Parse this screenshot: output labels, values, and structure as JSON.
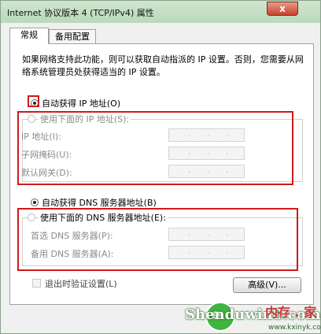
{
  "window": {
    "title": "Internet 协议版本 4 (TCP/IPv4) 属性",
    "close": "x"
  },
  "tabs": [
    {
      "label": "常规"
    },
    {
      "label": "备用配置"
    }
  ],
  "description": "如果网络支持此功能，则可以获取自动指派的 IP 设置。否则，您需要从网络系统管理员处获得适当的 IP 设置。",
  "ip": {
    "auto_label": "自动获得 IP 地址(O)",
    "manual_label": "使用下面的 IP 地址(S):",
    "fields": [
      {
        "label": "IP 地址(I):"
      },
      {
        "label": "子网掩码(U):"
      },
      {
        "label": "默认网关(D):"
      }
    ]
  },
  "dns": {
    "auto_label": "自动获得 DNS 服务器地址(B)",
    "manual_label": "使用下面的 DNS 服务器地址(E):",
    "fields": [
      {
        "label": "首选 DNS 服务器(P):"
      },
      {
        "label": "备用 DNS 服务器(A):"
      }
    ]
  },
  "validate_label": "退出时验证设置(L)",
  "advanced_label": "高级(V)...",
  "ip_dot": ".",
  "watermark": {
    "brand": "Shenduwin8.com",
    "site": "www.kxinyk.com",
    "cn": "内存 . 家"
  },
  "colors": {
    "highlight": "#d01a1a",
    "titlebar": "#b9d9b9"
  }
}
